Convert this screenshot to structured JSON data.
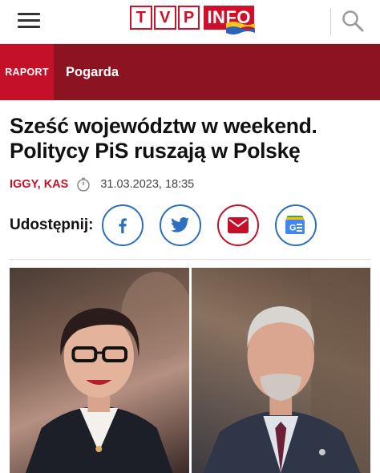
{
  "header": {
    "logo_letters": [
      "T",
      "V",
      "P"
    ],
    "logo_info": "INFO",
    "menu_icon": "hamburger-menu-icon",
    "search_icon": "magnifier-icon"
  },
  "section": {
    "tag": "RAPORT",
    "name": "Pogarda",
    "tag_color": "#c41028",
    "bar_color": "#8b1420"
  },
  "article": {
    "title": "Sześć województw w weekend. Politycy PiS ruszają w Polskę",
    "authors": "IGGY, KAS",
    "date": "31.03.2023, 18:35"
  },
  "share": {
    "label": "Udostępnij:",
    "buttons": [
      {
        "icon": "facebook-icon",
        "color": "#2c6fbf"
      },
      {
        "icon": "twitter-icon",
        "color": "#2c6fbf"
      },
      {
        "icon": "email-icon",
        "color": "#c41028"
      },
      {
        "icon": "google-news-icon",
        "color": "#2c6fbf"
      }
    ]
  },
  "images": [
    {
      "subject": "woman-portrait"
    },
    {
      "subject": "man-portrait"
    }
  ]
}
